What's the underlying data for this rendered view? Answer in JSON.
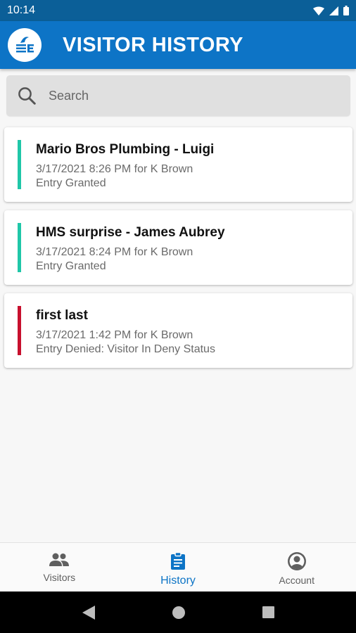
{
  "status_bar": {
    "time": "10:14"
  },
  "app_bar": {
    "title": "VISITOR HISTORY"
  },
  "search": {
    "placeholder": "Search",
    "value": ""
  },
  "history": [
    {
      "name": "Mario Bros Plumbing - Luigi",
      "datetime": "3/17/2021 8:26 PM for K Brown",
      "result": "Entry Granted",
      "status": "granted"
    },
    {
      "name": "HMS surprise - James Aubrey",
      "datetime": "3/17/2021 8:24 PM for K Brown",
      "result": "Entry Granted",
      "status": "granted"
    },
    {
      "name": "first last",
      "datetime": "3/17/2021 1:42 PM for K Brown",
      "result": "Entry Denied: Visitor In Deny Status",
      "status": "denied"
    }
  ],
  "bottom_nav": [
    {
      "label": "Visitors",
      "icon": "people-icon",
      "active": false
    },
    {
      "label": "History",
      "icon": "clipboard-icon",
      "active": true
    },
    {
      "label": "Account",
      "icon": "account-circle-icon",
      "active": false
    }
  ],
  "colors": {
    "primary": "#0d74c6",
    "status_bar": "#0b5f98",
    "granted": "#1fc7a8",
    "denied": "#c8102e"
  }
}
